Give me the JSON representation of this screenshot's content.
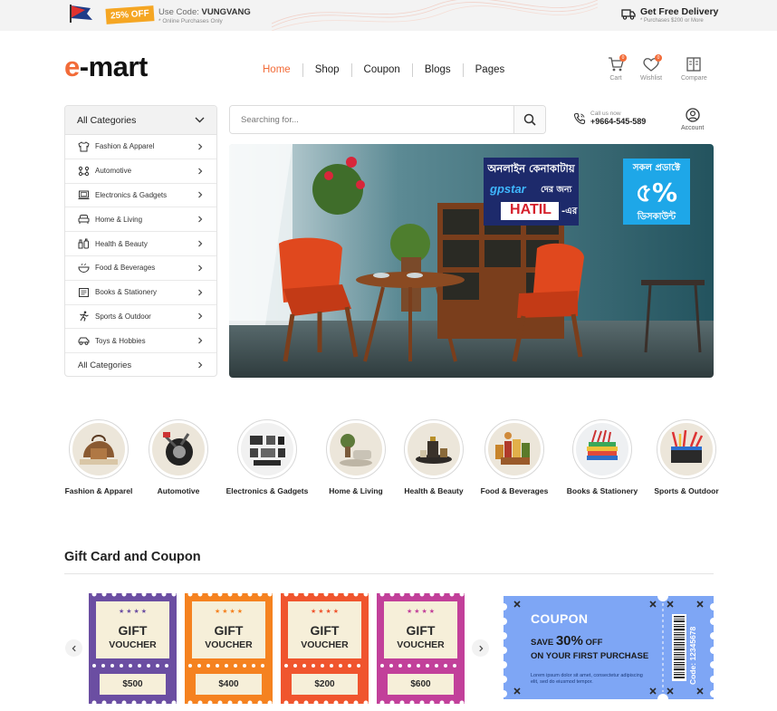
{
  "topbar": {
    "badge": "25% OFF",
    "use_code_label": "Use Code:",
    "code": "VUNGVANG",
    "online_note": "* Online Purchases Only",
    "free_delivery": "Get Free Delivery",
    "purchase_note": "* Purchases $200 or More"
  },
  "header": {
    "logo_e": "e",
    "logo_rest": "-mart",
    "nav": [
      "Home",
      "Shop",
      "Coupon",
      "Blogs",
      "Pages"
    ],
    "icons": {
      "cart": {
        "label": "Cart",
        "count": "0"
      },
      "wishlist": {
        "label": "Wishlist",
        "count": "0"
      },
      "compare": {
        "label": "Compare"
      }
    },
    "accent_color": "#f26b38"
  },
  "sidebar": {
    "header": "All Categories",
    "items": [
      {
        "label": "Fashion & Apparel",
        "icon": "shirt-icon"
      },
      {
        "label": "Automotive",
        "icon": "engine-icon"
      },
      {
        "label": "Electronics & Gadgets",
        "icon": "laptop-icon"
      },
      {
        "label": "Home & Living",
        "icon": "sofa-icon"
      },
      {
        "label": "Health & Beauty",
        "icon": "beauty-icon"
      },
      {
        "label": "Food & Beverages",
        "icon": "bowl-icon"
      },
      {
        "label": "Books & Stationery",
        "icon": "book-icon"
      },
      {
        "label": "Sports & Outdoor",
        "icon": "running-icon"
      },
      {
        "label": "Toys & Hobbies",
        "icon": "toy-car-icon"
      }
    ],
    "footer": "All Categories"
  },
  "search": {
    "placeholder": "Searching for...",
    "call_label": "Call us now",
    "phone": "+9664-545-589",
    "account": "Account"
  },
  "banner": {
    "line1": "অনলাইন কেনাকাটায়",
    "brand": "gpstar",
    "line2": "দের জন্য",
    "hatil": "HATIL",
    "line3": "-এর",
    "offer_top": "সকল প্রডাক্টে",
    "offer_pct": "৫%",
    "offer_bottom": "ডিসকাউন্ট"
  },
  "categories": [
    {
      "label": "Fashion & Apparel"
    },
    {
      "label": "Automotive"
    },
    {
      "label": "Electronics & Gadgets"
    },
    {
      "label": "Home & Living"
    },
    {
      "label": "Health & Beauty"
    },
    {
      "label": "Food & Beverages"
    },
    {
      "label": "Books & Stationery"
    },
    {
      "label": "Sports & Outdoor"
    }
  ],
  "gift": {
    "title": "Gift Card and Coupon",
    "vouchers": [
      {
        "line1": "GIFT",
        "line2": "VOUCHER",
        "price": "$500",
        "color": "#6b4ea2"
      },
      {
        "line1": "GIFT",
        "line2": "VOUCHER",
        "price": "$400",
        "color": "#f58220"
      },
      {
        "line1": "GIFT",
        "line2": "VOUCHER",
        "price": "$200",
        "color": "#f0552e"
      },
      {
        "line1": "GIFT",
        "line2": "VOUCHER",
        "price": "$600",
        "color": "#c2409a"
      }
    ],
    "coupon": {
      "title": "COUPON",
      "save": "SAVE",
      "pct": "30%",
      "off": "OFF",
      "first": "ON YOUR FIRST PURCHASE",
      "lorem": "Lorem ipsum dolor sit amet, consectetur adipiscing elit, sed do eiusmod tempor.",
      "code": "Code: 12345678",
      "color": "#7ea6f5"
    }
  }
}
